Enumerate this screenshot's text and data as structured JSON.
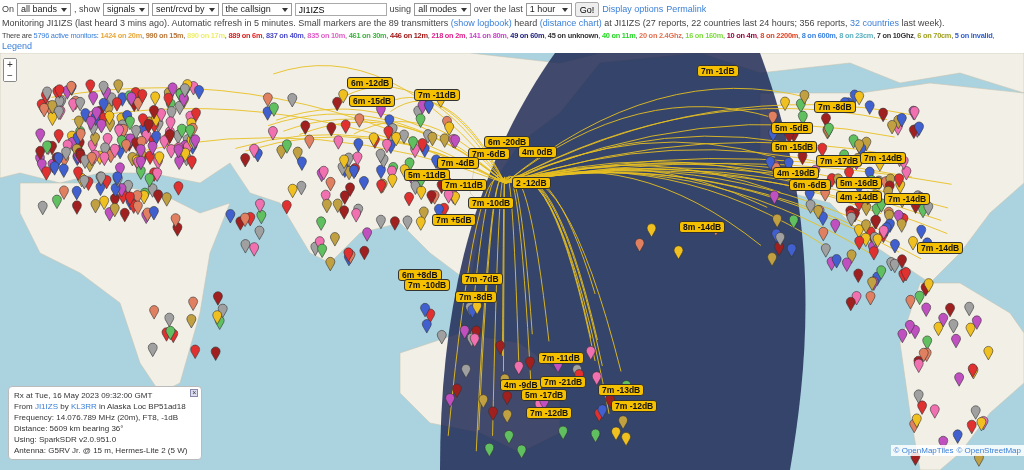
{
  "controls": {
    "on_label": "On",
    "bands": "all bands",
    "show_label": ", show",
    "show": "signals",
    "direction": "sent/rcvd by",
    "target": "the callsign",
    "callsign": "JI1IZS",
    "using_label": "using",
    "modes": "all modes",
    "over_label": "over the last",
    "period": "1 hour",
    "go": "Go!",
    "links": [
      "Display options",
      "Permalink"
    ]
  },
  "status": [
    {
      "text": "Monitoring JI1IZS (last heard 3 mins ago). Automatic refresh in 5 minutes. Small markers are the 89 transmitters ",
      "link": false
    },
    {
      "text": "(show logbook)",
      "link": true
    },
    {
      "text": " heard ",
      "link": false
    },
    {
      "text": "(distance chart)",
      "link": true
    },
    {
      "text": " at JI1IZS (27 reports, 22 countries last 24 hours; 356 reports, ",
      "link": false
    },
    {
      "text": "32 countries",
      "link": true
    },
    {
      "text": " last week).",
      "link": false
    }
  ],
  "monitors": {
    "intro": "There are ",
    "count_link": "5796 active monitors",
    "colon": ": ",
    "bands": [
      {
        "text": "1424 on 20m",
        "color": "#e8a83a",
        "sep": ", "
      },
      {
        "text": "990 on 15m",
        "color": "#b9773a",
        "sep": ", "
      },
      {
        "text": "890 on 17m",
        "color": "#eeee66",
        "sep": ", "
      },
      {
        "text": "889 on 6m",
        "color": "#e01c1c",
        "sep": ", "
      },
      {
        "text": "837 on 40m",
        "color": "#4a4ac8",
        "sep": ", "
      },
      {
        "text": "835 on 10m",
        "color": "#e060c8",
        "sep": ", "
      },
      {
        "text": "461 on 30m",
        "color": "#3cb43c",
        "sep": ", "
      },
      {
        "text": "446 on 12m",
        "color": "#a01818",
        "sep": ", "
      },
      {
        "text": "218 on 2m",
        "color": "#e0208c",
        "sep": ", "
      },
      {
        "text": "141 on 80m",
        "color": "#d040d0",
        "sep": ", "
      },
      {
        "text": "49 on 60m",
        "color": "#20207c",
        "sep": ", "
      },
      {
        "text": "45 on unknown",
        "color": "#333333",
        "sep": ", "
      },
      {
        "text": "40 on 11m",
        "color": "#22d822",
        "sep": ", "
      },
      {
        "text": "20 on 2.4Ghz",
        "color": "#e07050",
        "sep": ", "
      },
      {
        "text": "16 on 160m",
        "color": "#7cdc3c",
        "sep": ", "
      },
      {
        "text": "10 on 4m",
        "color": "#a0003c",
        "sep": ", "
      },
      {
        "text": "8 on 2200m",
        "color": "#e04020",
        "sep": ", "
      },
      {
        "text": "8 on 600m",
        "color": "#3a80e0",
        "sep": ", "
      },
      {
        "text": "8 on 23cm",
        "color": "#5cb0c0",
        "sep": ", "
      },
      {
        "text": "7 on 10Ghz",
        "color": "#333333",
        "sep": ", "
      },
      {
        "text": "6 on 70cm",
        "color": "#a0a020",
        "sep": ", "
      },
      {
        "text": "5 on invalid",
        "color": "#3060d0",
        "sep": ","
      }
    ]
  },
  "legend": "Legend",
  "map": {
    "zoom_in": "+",
    "zoom_out": "−",
    "reports": [
      "6m -12dB",
      "7m -11dB",
      "6m -15dB",
      "7m -1dB",
      "6m -20dB",
      "7m -6dB",
      "4m 0dB",
      "7m -4dB",
      "5m -11dB",
      "7m -11dB",
      "2 -12dB",
      "7m -10dB",
      "7m +5dB",
      "8m -14dB",
      "6m +8dB",
      "7m -10dB",
      "7m -7dB",
      "7m -8dB",
      "7m -11dB",
      "4m -9dB",
      "7m -21dB",
      "5m -17dB",
      "7m -13dB",
      "7m -12dB",
      "7m -12dB",
      "7m -8dB",
      "5m -5dB",
      "5m -15dB",
      "7m -17dB",
      "7m -14dB",
      "4m -19dB",
      "6m -6dB",
      "5m -16dB",
      "4m -14dB",
      "7m -14dB",
      "7m -14dB"
    ],
    "popup": {
      "close": "×",
      "lines": [
        [
          {
            "text": "Rx at Tue, 16 May 2023 09:32:00 GMT",
            "link": false
          }
        ],
        [
          {
            "text": "From ",
            "link": false
          },
          {
            "text": "JI1IZS",
            "link": true
          },
          {
            "text": " by ",
            "link": false
          },
          {
            "text": "KL3RR",
            "link": true
          },
          {
            "text": " in Alaska Loc BP51ad18",
            "link": false
          }
        ],
        [
          {
            "text": "Frequency: 14.076.789 MHz (20m), FT8, -1dB",
            "link": false
          }
        ],
        [
          {
            "text": "Distance: 5609 km bearing 36°",
            "link": false
          }
        ],
        [
          {
            "text": "Using: SparkSDR v2.0.951.0",
            "link": false
          }
        ],
        [
          {
            "text": "Antenna: G5RV Jr. @ 15 m, Hermes-Lite 2 (5 W)",
            "link": false
          }
        ]
      ]
    },
    "attribution": [
      "© OpenMapTiles",
      "© OpenStreetMap"
    ]
  }
}
